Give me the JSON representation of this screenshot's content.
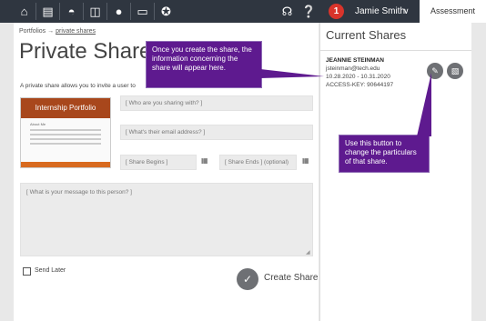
{
  "nav": {
    "icons": [
      "home-icon",
      "contact-card-icon",
      "portfolio-icon",
      "briefcase-icon",
      "people-icon",
      "folder-icon",
      "badge-icon"
    ],
    "support_icon": "headset-icon",
    "help_icon": "help-icon",
    "alert_count": "1",
    "user_name": "Jamie Smith",
    "user_chevron": "∨",
    "assessment_tab": "Assessment"
  },
  "breadcrumb": {
    "root": "Portfolios",
    "separator": "→",
    "current": "private shares"
  },
  "page": {
    "title": "Private Share",
    "intro": "A private share allows you to invite a user to"
  },
  "thumbnail": {
    "title": "Internship Portfolio",
    "subtitle": "About Me"
  },
  "form": {
    "who_placeholder": "[ Who are you sharing with? ]",
    "email_placeholder": "[ What's their email address? ]",
    "begins_placeholder": "[ Share Begins ]",
    "ends_placeholder": "[ Share Ends ] (optional)",
    "message_placeholder": "[ What is your message to this person? ]",
    "send_later_label": "Send Later",
    "create_label": "Create Share",
    "calendar_icon": "calendar-icon",
    "check_icon": "check-icon"
  },
  "current_shares": {
    "title": "Current Shares",
    "name": "JEANNIE STEINMAN",
    "email": "jsteinman@tech.edu",
    "dates": "10.28.2020 - 10.31.2020",
    "access_key": "ACCESS-KEY: 90644197",
    "edit_icon": "pencil-icon",
    "delete_icon": "trash-icon"
  },
  "callouts": {
    "top": "Once you create the share, the information concerning the share will appear here.",
    "bottom": "Use this button to change the particulars of that share."
  },
  "colors": {
    "topbar": "#2f3640",
    "callout": "#5e1a8f",
    "badge": "#d9342b",
    "thumb_header": "#a8471c"
  }
}
